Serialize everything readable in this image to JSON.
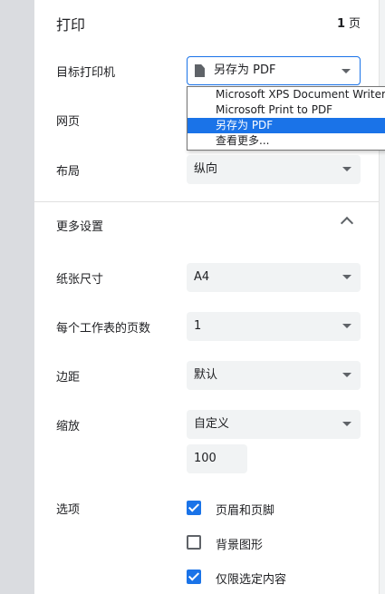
{
  "header": {
    "title": "打印",
    "page_count": "1",
    "page_unit": "页"
  },
  "destination": {
    "label": "目标打印机",
    "value": "另存为 PDF",
    "options": [
      "Microsoft XPS Document Writer",
      "Microsoft Print to PDF",
      "另存为 PDF",
      "查看更多..."
    ],
    "selected_index": 2
  },
  "pages": {
    "label": "网页"
  },
  "layout": {
    "label": "布局",
    "value": "纵向"
  },
  "more_settings": {
    "label": "更多设置"
  },
  "paper_size": {
    "label": "纸张尺寸",
    "value": "A4"
  },
  "pages_per_sheet": {
    "label": "每个工作表的页数",
    "value": "1"
  },
  "margins": {
    "label": "边距",
    "value": "默认"
  },
  "scale": {
    "label": "缩放",
    "value": "自定义",
    "custom_value": "100"
  },
  "options": {
    "label": "选项",
    "items": [
      {
        "label": "页眉和页脚",
        "checked": true
      },
      {
        "label": "背景图形",
        "checked": false
      },
      {
        "label": "仅限选定内容",
        "checked": true
      }
    ]
  },
  "colors": {
    "accent": "#1a73e8",
    "field_bg": "#f1f3f4",
    "side_bg": "#dadce0"
  }
}
